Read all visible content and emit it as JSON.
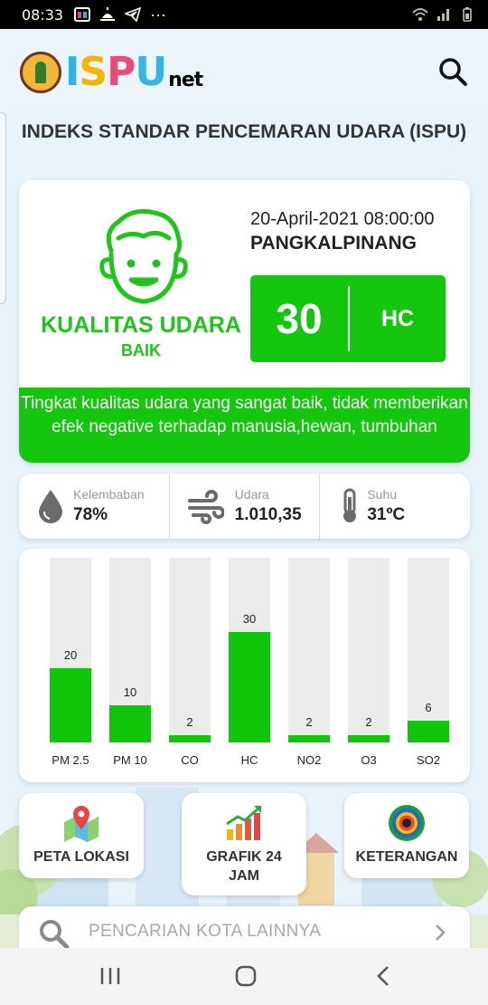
{
  "status_bar": {
    "time": "08:33",
    "more": "···"
  },
  "app": {
    "logo_letters": [
      "I",
      "S",
      "P",
      "U"
    ],
    "logo_colors": [
      "#2ab4e8",
      "#f5b400",
      "#e94c7a",
      "#32b6e6"
    ],
    "logo_suffix": "net",
    "search_icon": "search-icon"
  },
  "title": "INDEKS STANDAR PENCEMARAN UDARA (ISPU)",
  "summary": {
    "quality_label": "KUALITAS UDARA",
    "quality_value": "BAIK",
    "datetime": "20-April-2021 08:00:00",
    "city": "PANGKALPINANG",
    "index_value": "30",
    "index_param": "HC",
    "description": "Tingkat kualitas udara yang sangat baik, tidak memberikan efek negative terhadap manusia,hewan, tumbuhan",
    "status_color": "#14c60e"
  },
  "weather": [
    {
      "icon": "water-drop-icon",
      "label": "Kelembaban",
      "value": "78%"
    },
    {
      "icon": "wind-icon",
      "label": "Udara",
      "value": "1.010,35"
    },
    {
      "icon": "thermometer-icon",
      "label": "Suhu",
      "value": "31ºC"
    }
  ],
  "chart_data": {
    "type": "bar",
    "categories": [
      "PM 2.5",
      "PM 10",
      "CO",
      "HC",
      "NO2",
      "O3",
      "SO2"
    ],
    "values": [
      20,
      10,
      2,
      30,
      2,
      2,
      6
    ],
    "labels": [
      "20",
      "10",
      "2",
      "30",
      "2",
      "2",
      "6"
    ],
    "ylim": [
      0,
      50
    ],
    "bar_color": "#10c60a",
    "track_color": "#ebebeb"
  },
  "actions": [
    {
      "icon": "map-pin-icon",
      "label": "PETA LOKASI"
    },
    {
      "icon": "bar-chart-icon",
      "label": "GRAFIK 24 JAM"
    },
    {
      "icon": "legend-icon",
      "label": "KETERANGAN"
    }
  ],
  "search": {
    "placeholder": "PENCARIAN KOTA LAINNYA"
  }
}
